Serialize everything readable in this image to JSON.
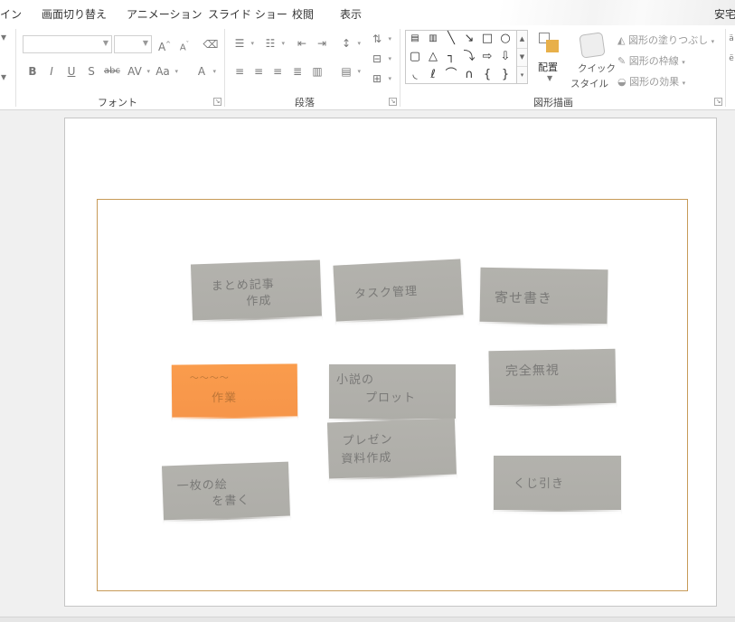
{
  "menu_tabs": [
    "イン",
    "画面切り替え",
    "アニメーション",
    "スライド ショー",
    "校閲",
    "表示",
    "安宅"
  ],
  "ribbon": {
    "font_group": {
      "label": "フォント",
      "font_name": "",
      "font_size": "",
      "buttons": [
        "B",
        "I",
        "U",
        "S",
        "abc",
        "AV",
        "Aa",
        "A"
      ]
    },
    "paragraph_group": {
      "label": "段落"
    },
    "drawing_group": {
      "label": "図形描画",
      "arrange_label": "配置",
      "quick_style_label_1": "クイック",
      "quick_style_label_2": "スタイル",
      "fill_label": "図形の塗りつぶし",
      "outline_label": "図形の枠線",
      "effects_label": "図形の効果"
    }
  },
  "shape_icons": [
    "text-box",
    "vertical-text-box",
    "line",
    "arrow-line",
    "rectangle",
    "oval",
    "rounded-rectangle",
    "triangle",
    "elbow-connector",
    "elbow-arrow-connector",
    "right-arrow",
    "down-arrow",
    "freeform",
    "scribble",
    "arc",
    "curve",
    "left-brace",
    "right-brace"
  ],
  "slide": {
    "notes": [
      {
        "text_1": "まとめ記事",
        "text_2": "作成",
        "color": "#b1b0ab"
      },
      {
        "text_1": "タスク管理",
        "text_2": "",
        "color": "#b1b0ab"
      },
      {
        "text_1": "寄せ書き",
        "text_2": "",
        "color": "#b1b0ab"
      },
      {
        "text_1": "～～～～",
        "text_2": "作業",
        "color": "#f89a4b"
      },
      {
        "text_1": "小説の",
        "text_2": "プロット",
        "color": "#b1b0ab"
      },
      {
        "text_1": "完全無視",
        "text_2": "",
        "color": "#b1b0ab"
      },
      {
        "text_1": "プレゼン",
        "text_2": "資料作成",
        "color": "#b1b0ab"
      },
      {
        "text_1": "一枚の絵",
        "text_2": "を書く",
        "color": "#b1b0ab"
      },
      {
        "text_1": "くじ引き",
        "text_2": "",
        "color": "#b1b0ab"
      }
    ]
  }
}
